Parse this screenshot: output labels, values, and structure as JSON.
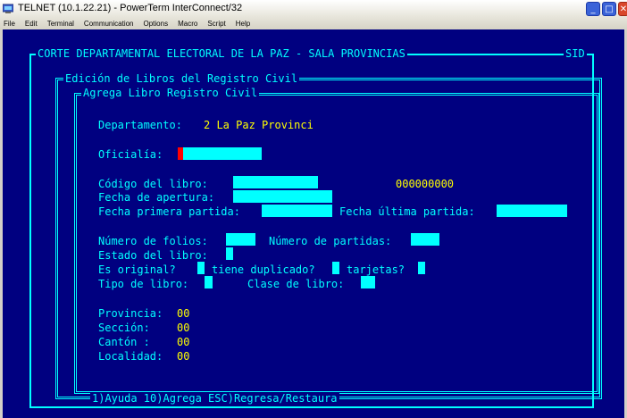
{
  "window": {
    "title": "TELNET (10.1.22.21) - PowerTerm InterConnect/32",
    "min_label": "_",
    "max_label": "□",
    "close_label": "✕"
  },
  "menu": [
    "File",
    "Edit",
    "Terminal",
    "Communication",
    "Options",
    "Macro",
    "Script",
    "Help"
  ],
  "screen": {
    "header": "CORTE DEPARTAMENTAL ELECTORAL DE LA PAZ - SALA PROVINCIAS",
    "header_right": "SID",
    "panel_title": "Edición de Libros del Registro Civil",
    "subpanel_title": "Agrega Libro Registro Civil",
    "departamento_label": "Departamento:",
    "departamento_value": "2 La Paz Provinci",
    "oficialia_label": "Oficialía:",
    "codigo_label": "Código del libro:",
    "codigo_value": "000000000",
    "fecha_apertura_label": "Fecha de apertura:",
    "fecha_primera_label": "Fecha primera partida:",
    "fecha_ultima_label": "Fecha última partida:",
    "num_folios_label": "Número de folios:",
    "num_partidas_label": "Número de partidas:",
    "estado_label": "Estado del libro:",
    "es_original_label": "Es original?",
    "tiene_duplicado_label": "tiene duplicado?",
    "tarjetas_label": "tarjetas?",
    "tipo_libro_label": "Tipo de libro:",
    "clase_libro_label": "Clase de libro:",
    "provincia_label": "Provincia:",
    "provincia_value": "00",
    "seccion_label": "Sección:",
    "seccion_value": "00",
    "canton_label": "Cantón :",
    "canton_value": "00",
    "localidad_label": "Localidad:",
    "localidad_value": "00",
    "footer": "1)Ayuda 10)Agrega ESC)Regresa/Restaura"
  },
  "colors": {
    "background": "#000080",
    "text": "#00ffff",
    "value": "#ffff00",
    "cursor": "#ff0000"
  }
}
